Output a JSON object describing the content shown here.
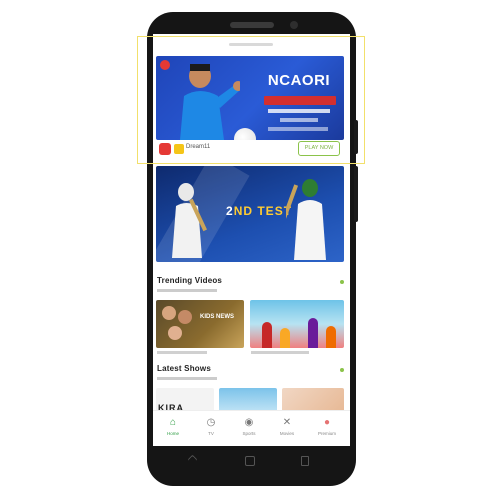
{
  "ad": {
    "headline": "NCAORI",
    "app_name": "Dream11",
    "cta": "PLAY NOW"
  },
  "banner": {
    "text_main": "2",
    "text_accent": "ND TEST"
  },
  "sections": [
    {
      "title": "Trending Videos"
    },
    {
      "title": "Latest Shows"
    }
  ],
  "cards": {
    "card1_text": "KIDS NEWS",
    "card3_text": "KIRA"
  },
  "nav": [
    {
      "label": "Home",
      "icon": "home-icon"
    },
    {
      "label": "TV",
      "icon": "tv-icon"
    },
    {
      "label": "Sports",
      "icon": "sports-icon"
    },
    {
      "label": "Movies",
      "icon": "movies-icon"
    },
    {
      "label": "Premium",
      "icon": "premium-icon"
    }
  ],
  "colors": {
    "accent": "#2e9d43",
    "banner_blue": "#1f45b8",
    "highlight": "#f2e06b"
  }
}
